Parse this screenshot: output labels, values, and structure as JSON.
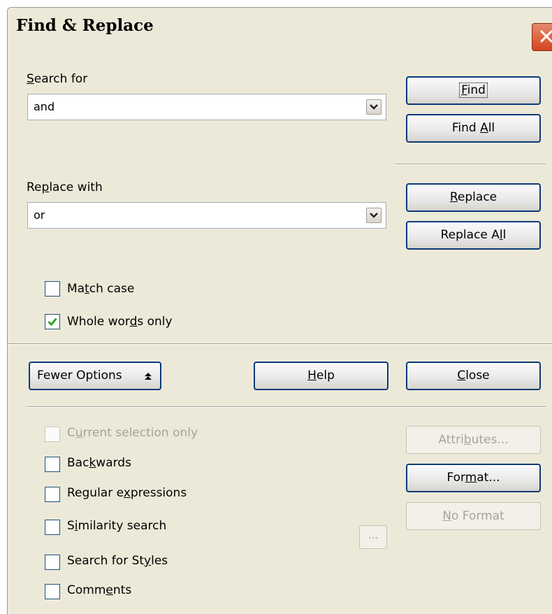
{
  "window": {
    "title": "Find & Replace"
  },
  "search": {
    "label": "Search for",
    "value": "and"
  },
  "replace": {
    "label": "Replace with",
    "value": "or"
  },
  "buttons": {
    "find": "Find",
    "find_all": "Find All",
    "replace": "Replace",
    "replace_all": "Replace All",
    "fewer_options": "Fewer Options",
    "help": "Help",
    "close": "Close",
    "attributes": "Attributes...",
    "format": "Format...",
    "no_format": "No Format",
    "similarity_settings": "..."
  },
  "options": {
    "match_case": {
      "label": "Match case",
      "checked": false
    },
    "whole_words": {
      "label": "Whole words only",
      "checked": true
    },
    "current_selection": {
      "label": "Current selection only",
      "checked": false,
      "enabled": false
    },
    "backwards": {
      "label": "Backwards",
      "checked": false
    },
    "regex": {
      "label": "Regular expressions",
      "checked": false
    },
    "similarity": {
      "label": "Similarity search",
      "checked": false
    },
    "styles": {
      "label": "Search for Styles",
      "checked": false
    },
    "comments": {
      "label": "Comments",
      "checked": false
    }
  },
  "icons": {
    "close": "close-x-icon",
    "dropdown": "chevron-down-icon",
    "collapse": "double-chevron-up-icon",
    "check": "checkmark-icon"
  },
  "colors": {
    "button_border": "#0b3a79",
    "dialog_bg": "#ece9d8",
    "close_red": "#d2451f",
    "check_green": "#21a121"
  }
}
